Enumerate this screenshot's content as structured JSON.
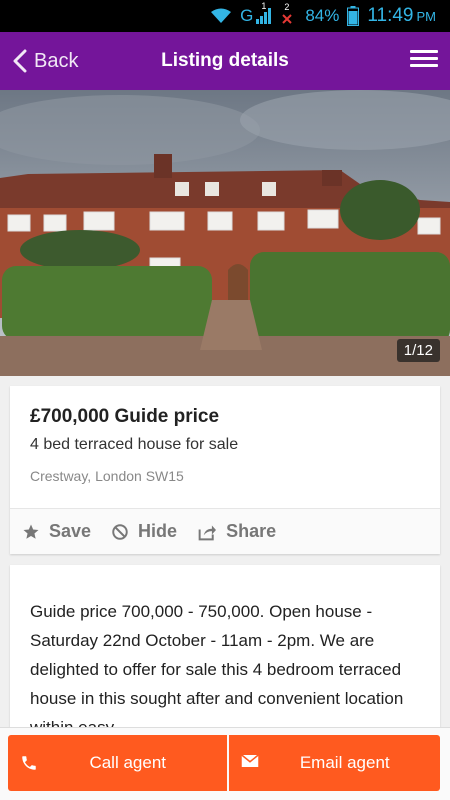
{
  "status_bar": {
    "network": "G",
    "sim_label": "1",
    "sim2_label": "2",
    "battery": "84%",
    "time": "11:49",
    "ampm": "PM"
  },
  "app_bar": {
    "back_label": "Back",
    "title": "Listing details"
  },
  "photo": {
    "counter": "1/12"
  },
  "listing": {
    "price": "£700,000 Guide price",
    "type": "4 bed terraced house for sale",
    "address": "Crestway, London SW15"
  },
  "actions": {
    "save": "Save",
    "hide": "Hide",
    "share": "Share"
  },
  "description": "Guide price 700,000 - 750,000. Open house - Saturday 22nd October - 11am - 2pm. We are delighted to offer for sale this 4 bedroom terraced house in this sought after and convenient location within easy",
  "bottom": {
    "call_label": "Call agent",
    "email_label": "Email agent"
  },
  "colors": {
    "app_bar": "#74159a",
    "cta": "#ff5a1f",
    "status_text": "#33b5e5"
  }
}
